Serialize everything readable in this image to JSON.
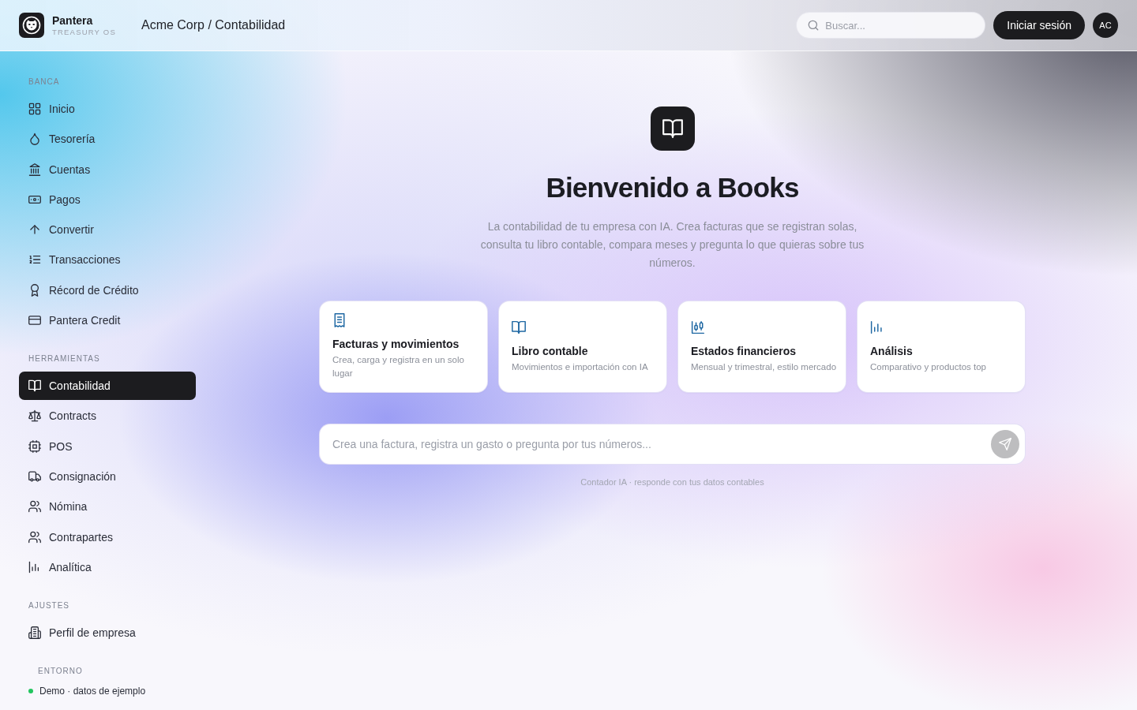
{
  "header": {
    "brand": {
      "name": "Pantera",
      "tagline": "TREASURY OS"
    },
    "breadcrumb": "Acme Corp / Contabilidad",
    "search": {
      "placeholder": "Buscar..."
    },
    "login_button": "Iniciar sesión",
    "avatar": "AC"
  },
  "sidebar": {
    "sections": [
      {
        "title": "BANCA",
        "items": [
          {
            "label": "Inicio",
            "selected": false
          },
          {
            "label": "Tesorería",
            "selected": false
          },
          {
            "label": "Cuentas",
            "selected": false
          },
          {
            "label": "Pagos",
            "selected": false
          },
          {
            "label": "Convertir",
            "selected": false
          },
          {
            "label": "Transacciones",
            "selected": false
          },
          {
            "label": "Récord de Crédito",
            "selected": false
          },
          {
            "label": "Pantera Credit",
            "selected": false
          }
        ]
      },
      {
        "title": "HERRAMIENTAS",
        "items": [
          {
            "label": "Contabilidad",
            "selected": true
          },
          {
            "label": "Contracts",
            "selected": false
          },
          {
            "label": "POS",
            "selected": false
          },
          {
            "label": "Consignación",
            "selected": false
          },
          {
            "label": "Nómina",
            "selected": false
          },
          {
            "label": "Contrapartes",
            "selected": false
          },
          {
            "label": "Analítica",
            "selected": false
          }
        ]
      },
      {
        "title": "AJUSTES",
        "items": [
          {
            "label": "Perfil de empresa",
            "selected": false
          }
        ]
      }
    ],
    "environment": {
      "title": "ENTORNO",
      "status": "Demo · datos de ejemplo"
    }
  },
  "main": {
    "title": "Bienvenido a Books",
    "description": "La contabilidad de tu empresa con IA. Crea facturas que se registran solas, consulta tu libro contable, compara meses y pregunta lo que quieras sobre tus números.",
    "cards": [
      {
        "title": "Facturas y movimientos",
        "description": "Crea, carga y registra en un solo lugar"
      },
      {
        "title": "Libro contable",
        "description": "Movimientos e importación con IA"
      },
      {
        "title": "Estados financieros",
        "description": "Mensual y trimestral, estilo mercado"
      },
      {
        "title": "Análisis",
        "description": "Comparativo y productos top"
      }
    ],
    "composer": {
      "placeholder": "Crea una factura, registra un gasto o pregunta por tus números..."
    },
    "note": "Contador IA · responde con tus datos contables"
  }
}
